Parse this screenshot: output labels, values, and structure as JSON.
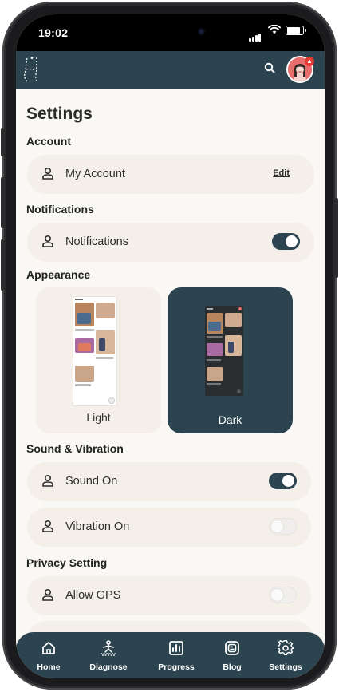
{
  "status_bar": {
    "time": "19:02"
  },
  "app_bar": {
    "logo_icon": "stylized-h-logo",
    "search_icon": "search-icon",
    "avatar_badge": "▲"
  },
  "page": {
    "title": "Settings",
    "account": {
      "section_label": "Account",
      "item_label": "My Account",
      "edit_label": "Edit"
    },
    "notifications": {
      "section_label": "Notifications",
      "item_label": "Notifications",
      "enabled": true
    },
    "appearance": {
      "section_label": "Appearance",
      "options": [
        {
          "label": "Light",
          "selected": false
        },
        {
          "label": "Dark",
          "selected": true
        }
      ]
    },
    "sound": {
      "section_label": "Sound & Vibration",
      "items": [
        {
          "label": "Sound On",
          "enabled": true
        },
        {
          "label": "Vibration On",
          "enabled": false
        }
      ]
    },
    "privacy": {
      "section_label": "Privacy Setting",
      "items": [
        {
          "label": "Allow GPS",
          "enabled": false
        }
      ]
    }
  },
  "bottom_nav": {
    "items": [
      {
        "label": "Home",
        "icon": "home-icon"
      },
      {
        "label": "Diagnose",
        "icon": "diagnose-icon"
      },
      {
        "label": "Progress",
        "icon": "progress-icon"
      },
      {
        "label": "Blog",
        "icon": "blog-icon"
      },
      {
        "label": "Settings",
        "icon": "settings-icon"
      }
    ],
    "active": "Settings"
  },
  "colors": {
    "primary": "#2c4450",
    "surface": "#f4efe8",
    "background": "#faf8f5"
  }
}
